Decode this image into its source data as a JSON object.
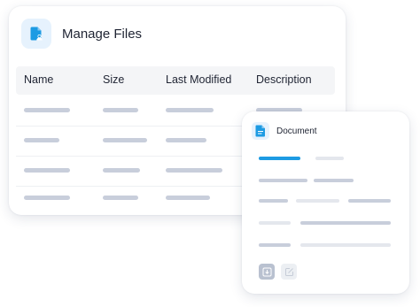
{
  "app": {
    "title": "Manage Files",
    "icon": "file-user-icon"
  },
  "table": {
    "columns": [
      "Name",
      "Size",
      "Last Modified",
      "Description"
    ],
    "rows": 4,
    "placeholder_color": "#c8cedb"
  },
  "document_panel": {
    "title": "Document",
    "icon": "document-icon",
    "active_tab_color": "#1d9be3",
    "actions": [
      "download-icon",
      "edit-icon"
    ]
  },
  "colors": {
    "accent": "#1d9be3",
    "accent_light": "#e6f2fd",
    "placeholder_dark": "#c8cedb",
    "placeholder_light": "#e4e7ed"
  }
}
